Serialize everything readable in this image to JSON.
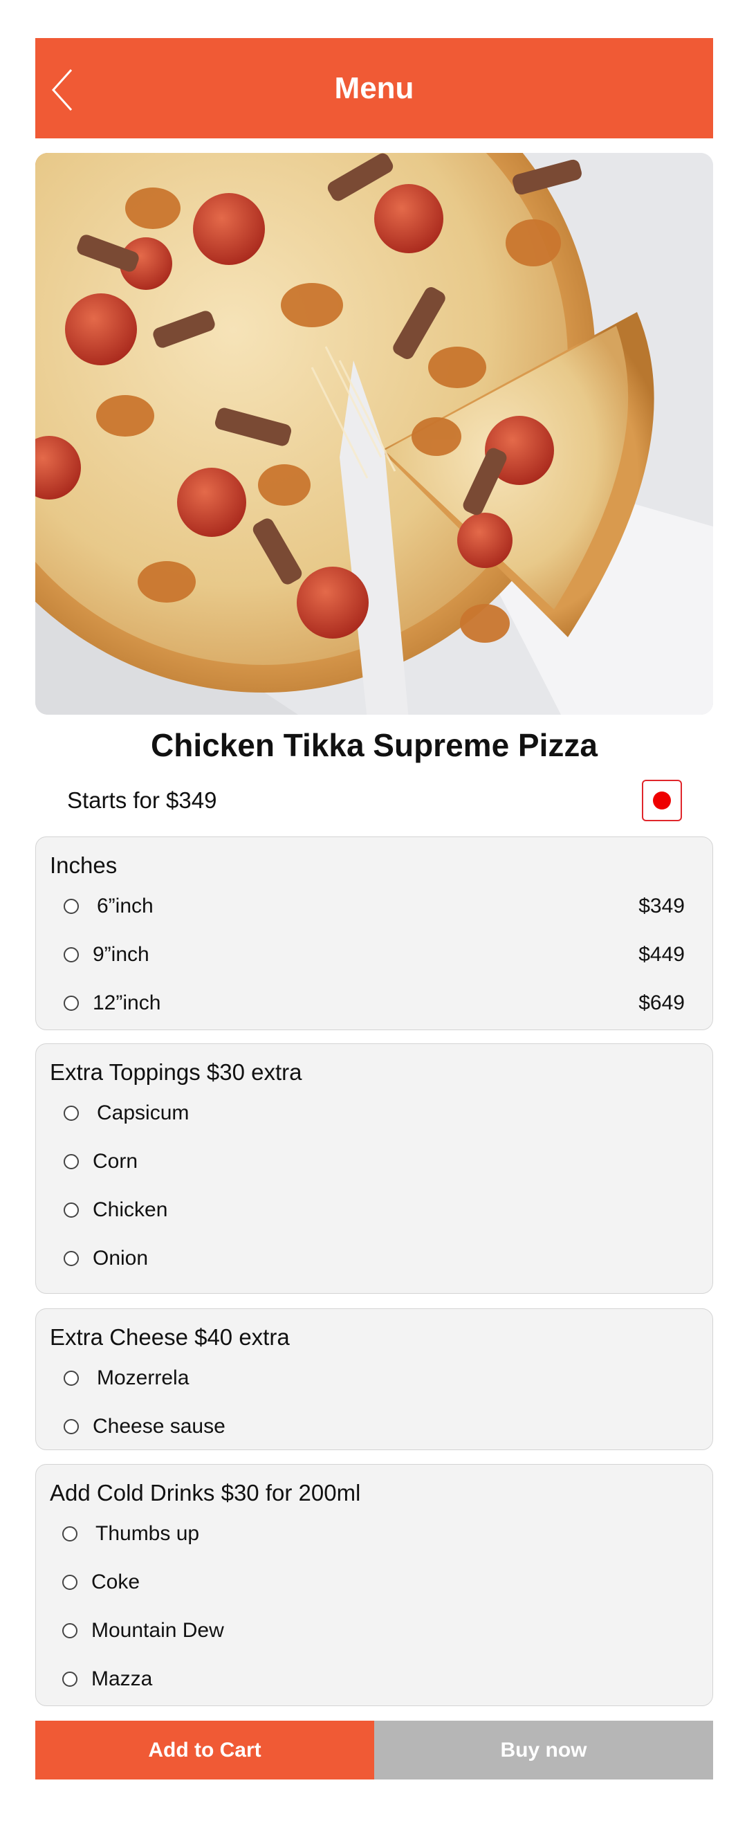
{
  "header": {
    "title": "Menu",
    "back_icon": "chevron-left-icon"
  },
  "product": {
    "image_icon": "pizza-photo",
    "name": "Chicken Tikka Supreme Pizza",
    "price_line": "Starts for $349",
    "fav_icon": "record-dot-icon"
  },
  "sizes": {
    "title": "Inches",
    "options": [
      {
        "label": "6”inch",
        "price": "$349"
      },
      {
        "label": "9”inch",
        "price": "$449"
      },
      {
        "label": "12”inch",
        "price": "$649"
      }
    ]
  },
  "toppings": {
    "title": "Extra Toppings $30 extra",
    "options": [
      {
        "label": "Capsicum"
      },
      {
        "label": "Corn"
      },
      {
        "label": "Chicken"
      },
      {
        "label": "Onion"
      }
    ]
  },
  "cheese": {
    "title": "Extra  Cheese $40 extra",
    "options": [
      {
        "label": "Mozerrela"
      },
      {
        "label": "Cheese sause"
      }
    ]
  },
  "drinks": {
    "title": "Add Cold Drinks $30 for 200ml",
    "options": [
      {
        "label": "Thumbs up"
      },
      {
        "label": "Coke"
      },
      {
        "label": "Mountain Dew"
      },
      {
        "label": "Mazza"
      }
    ]
  },
  "actions": {
    "add_to_cart": "Add to Cart",
    "buy_now": "Buy now"
  },
  "colors": {
    "accent": "#F05A35",
    "secondary_button": "#B6B6B6",
    "panel_bg": "#F3F3F3",
    "fav_red": "#EE0000"
  }
}
